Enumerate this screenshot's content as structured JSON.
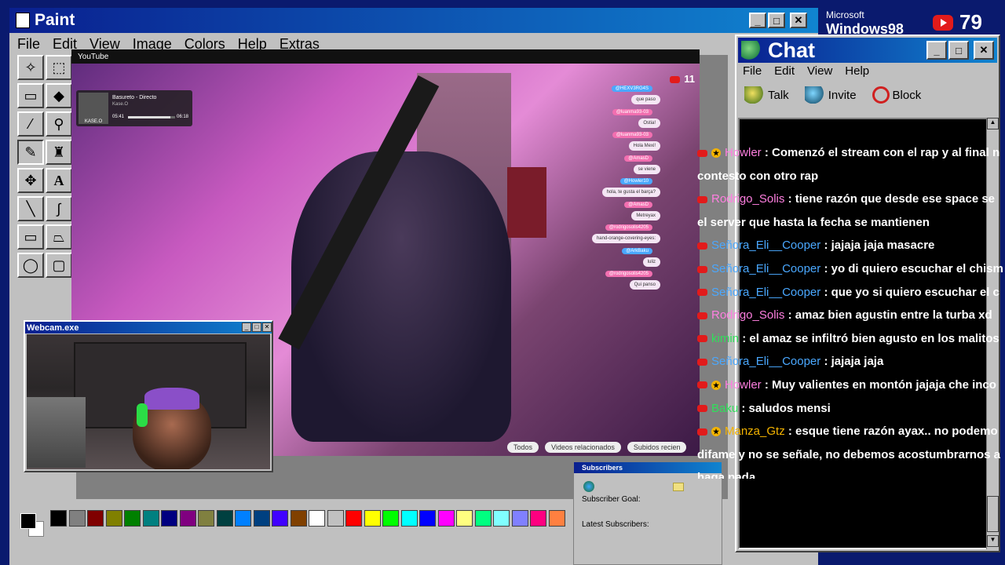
{
  "paint": {
    "title": "Paint",
    "menu": [
      "File",
      "Edit",
      "View",
      "Image",
      "Colors",
      "Help",
      "Extras"
    ]
  },
  "stream": {
    "site_label": "YouTube",
    "now_playing": {
      "title": "Basureto - Directo",
      "artist": "Kase.O",
      "elapsed": "05:41",
      "total": "06:18",
      "cover_text": "KASE.O",
      "progress": 0.9
    },
    "live_count": "11",
    "overlay_chat": [
      {
        "user": "@HEXV3RG4S",
        "text": "que paso",
        "color": "#4aa8ff"
      },
      {
        "user": "@luanma93-03",
        "text": "Ostia!",
        "color": "#f26fb0"
      },
      {
        "user": "@luanma93-03",
        "text": "Hola Mexi!",
        "color": "#f26fb0"
      },
      {
        "user": "@AmasD",
        "text": "se viene",
        "color": "#f26fb0"
      },
      {
        "user": "@Howler10",
        "text": "hola, te gusta el barça?",
        "color": "#4aa8ff"
      },
      {
        "user": "@AmasD",
        "text": "Metreyax",
        "color": "#f26fb0"
      },
      {
        "user": "@rodrigosolis4205",
        "text": "hand-orange-covering-eyes:",
        "color": "#f26fb0"
      },
      {
        "user": "@ArkBaku",
        "text": "luliz",
        "color": "#4aa8ff"
      },
      {
        "user": "@rodrigosolis4205",
        "text": "Qui panso",
        "color": "#f26fb0"
      }
    ],
    "tabs": [
      "Todos",
      "Videos relacionados",
      "Subidos recien"
    ]
  },
  "webcam": {
    "title": "Webcam.exe"
  },
  "subscribers": {
    "title": "Subscribers",
    "goal_label": "Subscriber Goal:",
    "latest_label": "Latest Subscribers:"
  },
  "chat": {
    "title": "Chat",
    "menu": [
      "File",
      "Edit",
      "View",
      "Help"
    ],
    "toolbar": [
      {
        "label": "Talk"
      },
      {
        "label": "Invite"
      },
      {
        "label": "Block"
      }
    ],
    "messages": [
      {
        "user": "Howler",
        "color": "#ff7fe0",
        "star": true,
        "text": ": Comenzó el stream con el rap y al final n"
      },
      {
        "user": "",
        "color": "#fff",
        "star": false,
        "cont": true,
        "text": "contesto con otro rap"
      },
      {
        "user": "Rodrigo_Solis",
        "color": "#ff7fe0",
        "star": false,
        "text": ": tiene razón que desde ese space se"
      },
      {
        "user": "",
        "color": "#fff",
        "star": false,
        "cont": true,
        "text": "el server que hasta la fecha se mantienen"
      },
      {
        "user": "Señora_Eli__Cooper",
        "color": "#4aa8ff",
        "star": false,
        "text": ": jajaja jaja masacre"
      },
      {
        "user": "Señora_Eli__Cooper",
        "color": "#4aa8ff",
        "star": false,
        "text": ": yo di quiero escuchar el chism"
      },
      {
        "user": "Señora_Eli__Cooper",
        "color": "#4aa8ff",
        "star": false,
        "text": ": que yo si quiero escuchar el c"
      },
      {
        "user": "Rodrigo_Solis",
        "color": "#ff7fe0",
        "star": false,
        "text": ": amaz bien agustin entre la turba xd"
      },
      {
        "user": "kimin",
        "color": "#2fe05a",
        "star": false,
        "text": ": el amaz se infiltró bien agusto en los malitos"
      },
      {
        "user": "Señora_Eli__Cooper",
        "color": "#4aa8ff",
        "star": false,
        "text": ": jajaja jaja"
      },
      {
        "user": "Howler",
        "color": "#ff7fe0",
        "star": true,
        "text": ": Muy valientes en montón jajaja che inco"
      },
      {
        "user": "Baku",
        "color": "#2fe05a",
        "star": false,
        "text": ": saludos mensi"
      },
      {
        "user": "Manza_Gtz",
        "color": "#f5b400",
        "star": true,
        "text": ": esque tiene razón ayax.. no podemo"
      },
      {
        "user": "",
        "color": "#fff",
        "star": false,
        "cont": true,
        "text": "difame y no se señale, no debemos acostumbrarnos a"
      },
      {
        "user": "",
        "color": "#fff",
        "star": false,
        "cont": true,
        "text": "haga nada"
      }
    ]
  },
  "overlay": {
    "os_brand_top": "Microsoft",
    "os_brand": "Windows98",
    "yt_count": "79"
  },
  "palette": [
    "#000000",
    "#808080",
    "#800000",
    "#808000",
    "#008000",
    "#008080",
    "#000080",
    "#800080",
    "#808040",
    "#004040",
    "#0080ff",
    "#004080",
    "#4000ff",
    "#804000",
    "#ffffff",
    "#c0c0c0",
    "#ff0000",
    "#ffff00",
    "#00ff00",
    "#00ffff",
    "#0000ff",
    "#ff00ff",
    "#ffff80",
    "#00ff80",
    "#80ffff",
    "#8080ff",
    "#ff0080",
    "#ff8040"
  ]
}
